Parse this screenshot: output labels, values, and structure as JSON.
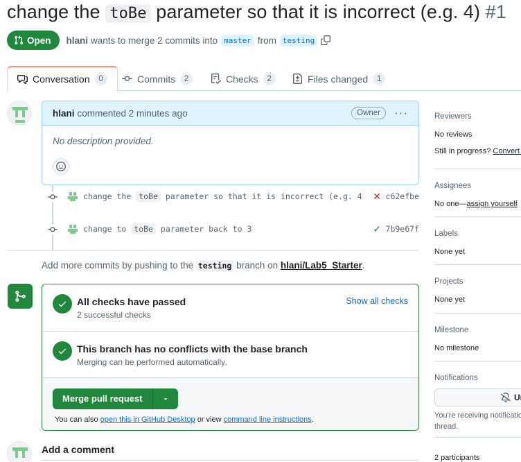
{
  "pr": {
    "title_prefix": "change the",
    "title_code": "toBe",
    "title_suffix": "parameter so that it is incorrect (e.g. 4)",
    "title_number": "#1"
  },
  "meta": {
    "state_label": "Open",
    "author": "hlani",
    "text_wants": "wants to merge 2 commits into",
    "base_branch": "master",
    "text_from": "from",
    "head_branch": "testing"
  },
  "tabs": [
    {
      "label": "Conversation",
      "count": "0",
      "icon": "comment-discussion-icon"
    },
    {
      "label": "Commits",
      "count": "2",
      "icon": "git-commit-icon"
    },
    {
      "label": "Checks",
      "count": "2",
      "icon": "checklist-icon"
    },
    {
      "label": "Files changed",
      "count": "1",
      "icon": "file-diff-icon"
    }
  ],
  "comment": {
    "author": "hlani",
    "action": "commented 2 minutes ago",
    "badge": "Owner",
    "menu": "···",
    "body": "No description provided."
  },
  "commits": [
    {
      "msg_prefix": "change the",
      "msg_code": "toBe",
      "msg_suffix": "parameter so that it is incorrect (e.g. 4",
      "status": "✕",
      "status_color": "#d1242f",
      "sha": "c62efbe"
    },
    {
      "msg_prefix": "change to",
      "msg_code": "toBe",
      "msg_suffix": "parameter back to 3",
      "status": "✓",
      "status_color": "#1a7f37",
      "sha": "7b9e67f"
    }
  ],
  "push_note": {
    "prefix": "Add more commits by pushing to the",
    "branch": "testing",
    "middle": "branch on",
    "repo": "hlani/Lab5_Starter",
    "suffix": "."
  },
  "merge": {
    "checks_title": "All checks have passed",
    "checks_sub": "2 successful checks",
    "show_all": "Show all checks",
    "conflict_title": "This branch has no conflicts with the base branch",
    "conflict_sub": "Merging can be performed automatically.",
    "merge_button": "Merge pull request",
    "also_prefix": "You can also",
    "also_link1": "open this in GitHub Desktop",
    "also_middle": "or view",
    "also_link2": "command line instructions",
    "also_suffix": "."
  },
  "add_comment": "Add a comment",
  "sidebar": {
    "reviewers_h": "Reviewers",
    "reviewers_v": "No reviews",
    "reviewers_progress": "Still in progress?",
    "reviewers_convert": "Convert t",
    "assignees_h": "Assignees",
    "assignees_v": "No one—",
    "assign_yourself": "assign yourself",
    "labels_h": "Labels",
    "labels_v": "None yet",
    "projects_h": "Projects",
    "projects_v": "None yet",
    "milestone_h": "Milestone",
    "milestone_v": "No milestone",
    "notifications_h": "Notifications",
    "unsub_label": "Un",
    "notif_text1": "You're receiving notificatio",
    "notif_text2": "thread.",
    "participants": "2 participants"
  },
  "colors": {
    "accent_green": "#1f883d",
    "link_blue": "#0969da",
    "tab_underline": "#fd8c73"
  }
}
